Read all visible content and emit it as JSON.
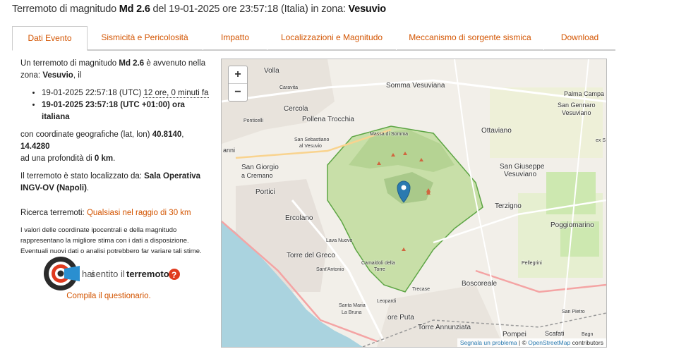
{
  "header": {
    "prefix": "Terremoto di magnitudo",
    "magnitude": "Md 2.6",
    "mid": "del 19-01-2025 ore 23:57:18 (Italia) in zona:",
    "zone": "Vesuvio"
  },
  "tabs": [
    {
      "label": "Dati Evento",
      "active": true
    },
    {
      "label": "Sismicità e Pericolosità"
    },
    {
      "label": "Impatto"
    },
    {
      "label": "Localizzazioni e Magnitudo"
    },
    {
      "label": "Meccanismo di sorgente sismica"
    },
    {
      "label": "Download"
    }
  ],
  "info": {
    "intro1": "Un terremoto di magnitudo",
    "magnitude": "Md 2.6",
    "intro2": "è avvenuto nella zona:",
    "zone": "Vesuvio",
    "intro3": ", il",
    "utc_time": "19-01-2025 22:57:18 (UTC)",
    "ago": "12 ore, 0 minuti fa",
    "local_time": "19-01-2025 23:57:18 (UTC +01:00) ora italiana",
    "coord_text": "con coordinate geografiche (lat, lon)",
    "lat": "40.8140",
    "lon": "14.4280",
    "depth_text": "ad una profondità di",
    "depth": "0 km",
    "located_text": "Il terremoto è stato localizzato da:",
    "located_by": "Sala Operativa INGV-OV (Napoli)",
    "search_label": "Ricerca terremoti:",
    "search_link": "Qualsiasi nel raggio di 30 km",
    "disclaimer": "I valori delle coordinate ipocentrali e della magnitudo rappresentano la migliore stima con i dati a disposizione. Eventuali nuovi dati o analisi potrebbero far variare tali stime."
  },
  "hst": {
    "logo_text_1": "hai",
    "logo_text_2": "sentito",
    "logo_text_3": "il",
    "logo_text_4": "terremoto",
    "question": "?",
    "compila": "Compila il questionario."
  },
  "map": {
    "zoom_in": "+",
    "zoom_out": "−",
    "attribution_link": "Segnala un problema",
    "attribution_sep": " | © ",
    "osm": "OpenStreetMap",
    "contributors": " contributors",
    "labels": {
      "volla": "Volla",
      "caravita": "Caravita",
      "somma": "Somma Vesuviana",
      "palma": "Palma Campa",
      "cercola": "Cercola",
      "pollena": "Pollena Trocchia",
      "sangennaro": "San Gennaro",
      "vesuviano": "Vesuviano",
      "ottaviano": "Ottaviano",
      "ponticelli": "Ponticelli",
      "sansebastiano": "San Sebastiano",
      "alvesuvio": "al Vesuvio",
      "massa": "Massa di Somma",
      "exs": "ex S",
      "anni": "anni",
      "sangiorgio": "San Giorgio",
      "cremano": "a Cremano",
      "sangiuseppe": "San Giuseppe",
      "sgvesuviano": "Vesuviano",
      "portici": "Portici",
      "terzigno": "Terzigno",
      "ercolano": "Ercolano",
      "poggiomarino": "Poggiomarino",
      "lavanuovo": "Lava Nuovo",
      "torredelgreco": "Torre del Greco",
      "pellegrini": "Pellegrini",
      "santantonio": "Sant'Antonio",
      "camaldoli": "Camaldoli della",
      "torre": "Torre",
      "boscoreale": "Boscoreale",
      "trecase": "Trecase",
      "leopardi": "Leopardi",
      "santamaria": "Santa Maria",
      "labruna": "La Bruna",
      "oreputa": "ore Puta",
      "sanpietro": "San Pietro",
      "torreannunziata": "Torre Annunziata",
      "scafati": "Scafati",
      "pompei": "Pompei",
      "bagn": "Bagn"
    }
  },
  "colors": {
    "accent": "#d35400",
    "marker": "#2a7ab0",
    "sea": "#aad3df",
    "park": "#c8dfa8"
  }
}
